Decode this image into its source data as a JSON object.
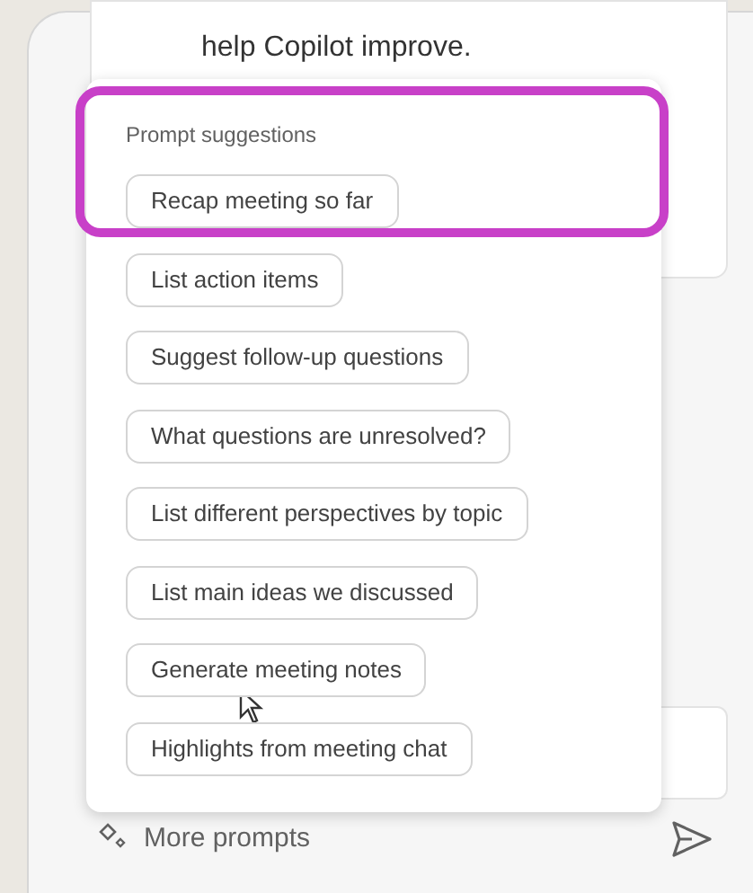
{
  "message": {
    "text": "help Copilot improve."
  },
  "prompt_menu": {
    "heading": "Prompt suggestions",
    "suggestions": [
      {
        "label": "Recap meeting so far",
        "highlighted": true
      },
      {
        "label": "List action items",
        "highlighted": false
      },
      {
        "label": "Suggest follow-up questions",
        "highlighted": false
      },
      {
        "label": "What questions are unresolved?",
        "highlighted": false
      },
      {
        "label": "List different perspectives by topic",
        "highlighted": false
      },
      {
        "label": "List main ideas we discussed",
        "highlighted": false
      },
      {
        "label": "Generate meeting notes",
        "highlighted": false
      },
      {
        "label": "Highlights from meeting chat",
        "highlighted": false
      }
    ]
  },
  "composer": {
    "more_prompts": "More prompts"
  }
}
